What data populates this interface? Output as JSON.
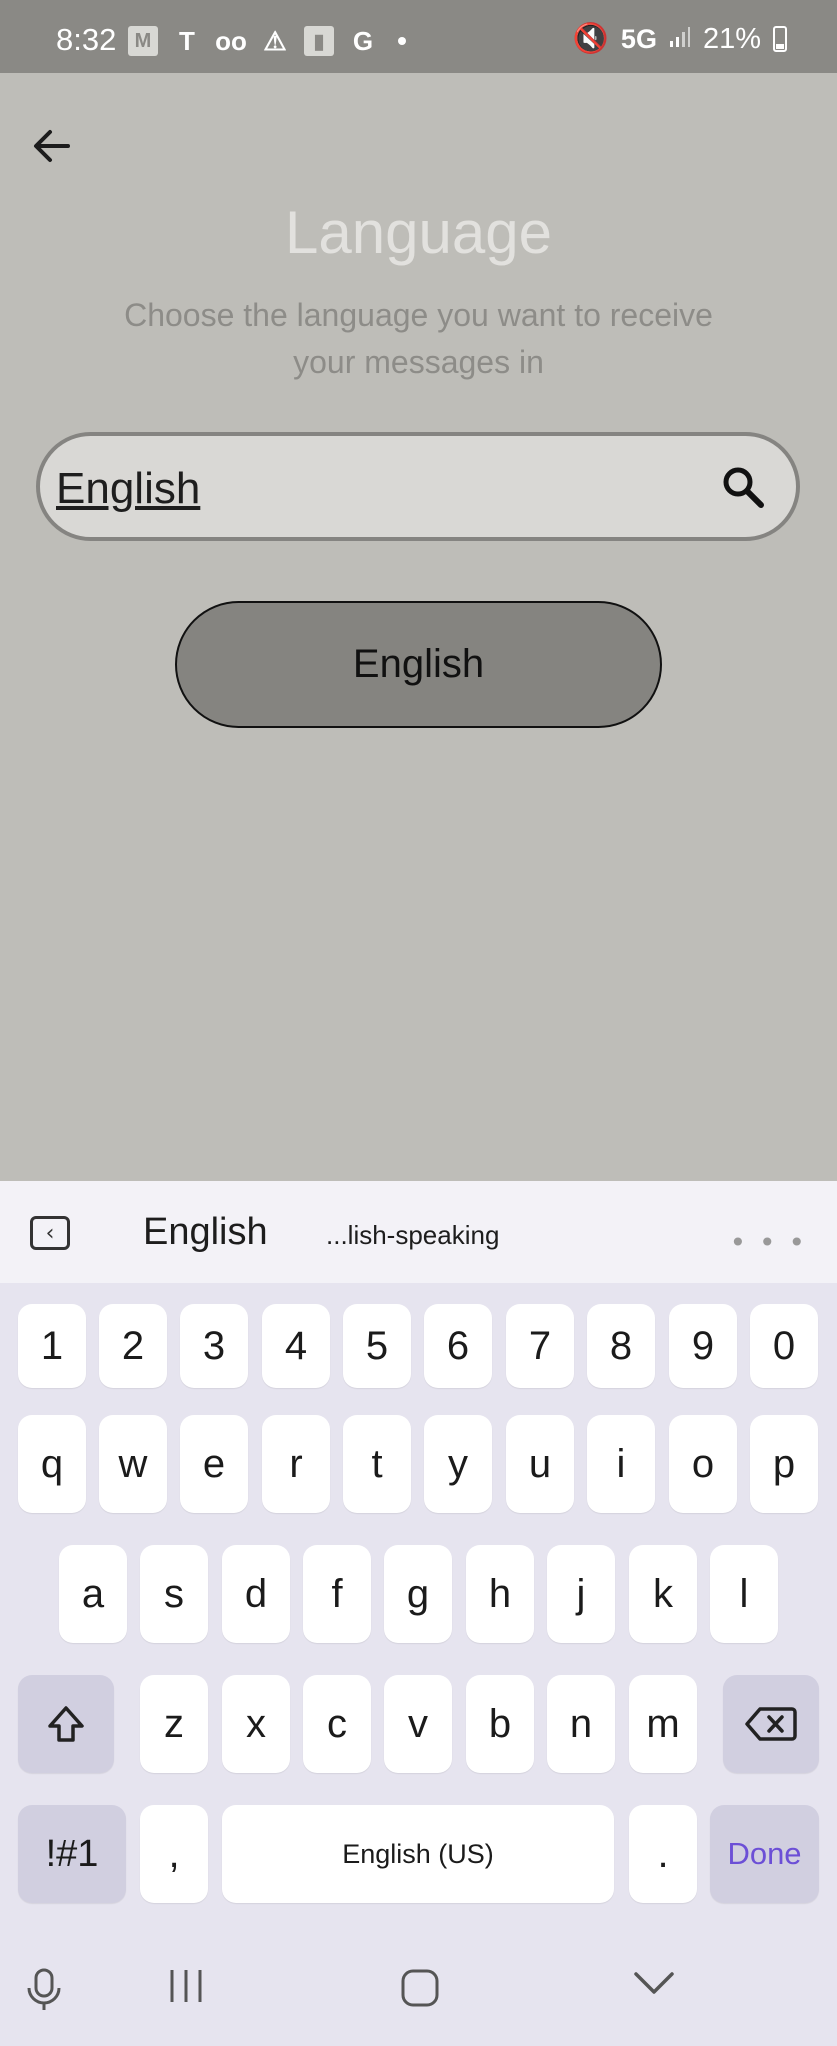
{
  "status_bar": {
    "time": "8:32",
    "network": "5G",
    "battery": "21%",
    "icons": [
      "gmail-icon",
      "t-mobile-icon",
      "voicemail-icon",
      "alert-icon",
      "file-icon",
      "google-icon"
    ]
  },
  "screen": {
    "title": "Language",
    "subtitle": "Choose the language you want to receive your messages in",
    "search": {
      "value": "English"
    },
    "result_label": "English"
  },
  "keyboard": {
    "suggestions": [
      "English",
      "...lish-speaking"
    ],
    "row_numbers": [
      "1",
      "2",
      "3",
      "4",
      "5",
      "6",
      "7",
      "8",
      "9",
      "0"
    ],
    "row_1": [
      "q",
      "w",
      "e",
      "r",
      "t",
      "y",
      "u",
      "i",
      "o",
      "p"
    ],
    "row_2": [
      "a",
      "s",
      "d",
      "f",
      "g",
      "h",
      "j",
      "k",
      "l"
    ],
    "row_3": [
      "z",
      "x",
      "c",
      "v",
      "b",
      "n",
      "m"
    ],
    "symbols_label": "!#1",
    "comma": ",",
    "space_label": "English (US)",
    "period": ".",
    "done_label": "Done"
  },
  "colors": {
    "accent": "#6c4fd6",
    "overlay": "#bebdb8"
  }
}
